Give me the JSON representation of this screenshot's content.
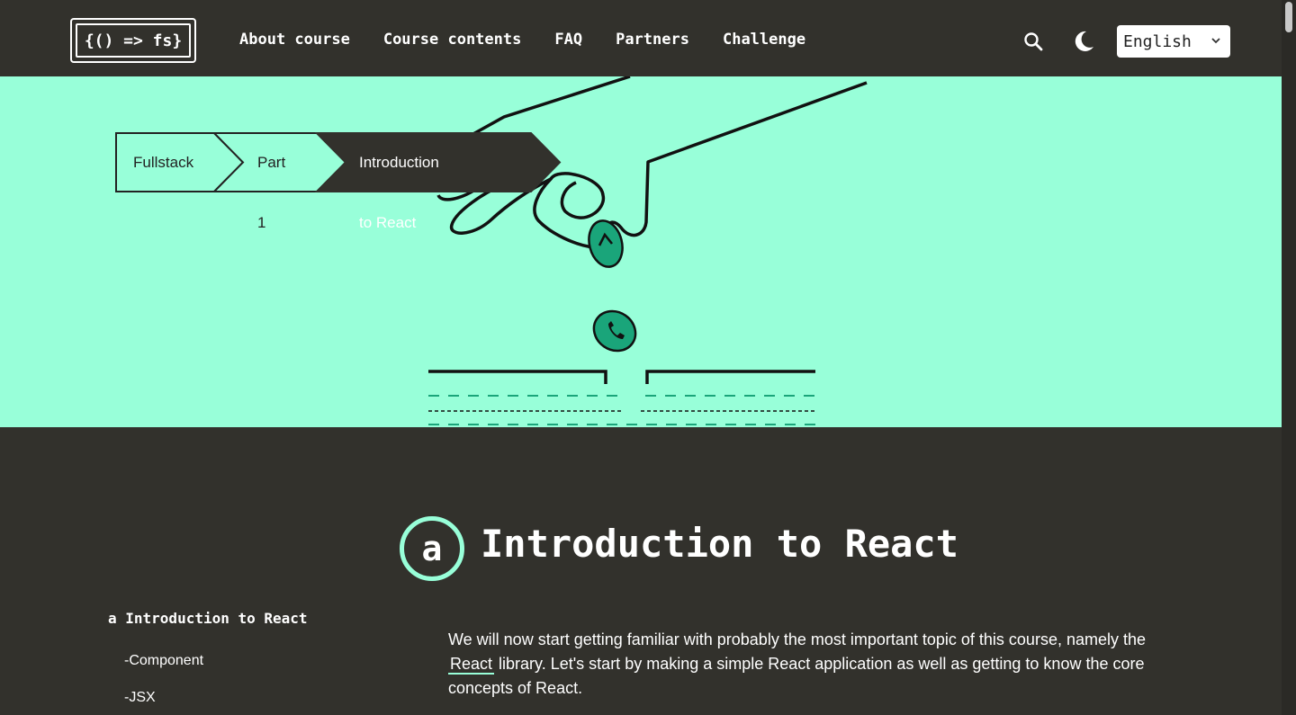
{
  "header": {
    "logo_text": "{() => fs}",
    "nav": [
      "About course",
      "Course contents",
      "FAQ",
      "Partners",
      "Challenge"
    ],
    "language": "English"
  },
  "breadcrumb": [
    "Fullstack",
    "Part 1",
    "Introduction to React"
  ],
  "section": {
    "letter": "a",
    "title": "Introduction to React"
  },
  "toc": {
    "heading": "a Introduction to React",
    "items": [
      "-Component",
      "-JSX"
    ]
  },
  "content": {
    "p1_before": "We will now start getting familiar with probably the most important topic of this course, namely the",
    "p1_link": "React",
    "p1_after": "library. Let's start by making a simple React application as well as getting to know the core concepts of React."
  },
  "colors": {
    "background": "#32312c",
    "accent": "#98ffd9",
    "coin": "#1aa57a"
  }
}
